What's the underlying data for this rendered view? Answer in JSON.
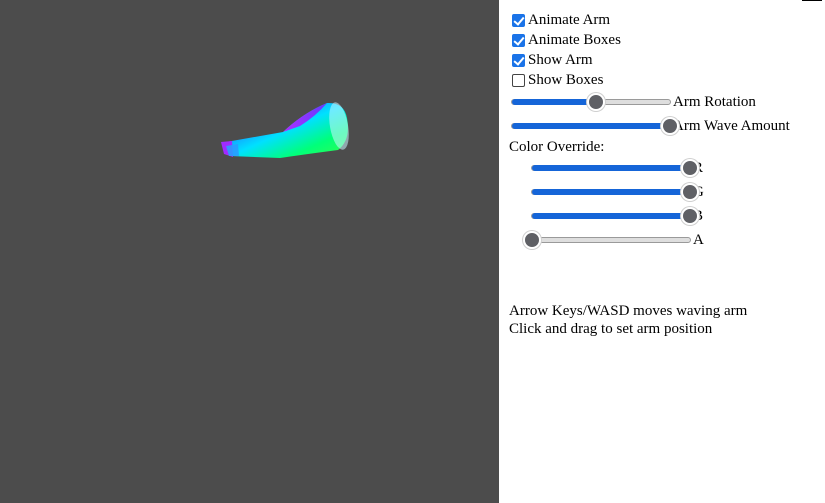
{
  "viewport": {
    "background": "#4c4c4c"
  },
  "controls": {
    "checkboxes": [
      {
        "label": "Animate Arm",
        "checked": true
      },
      {
        "label": "Animate Boxes",
        "checked": true
      },
      {
        "label": "Show Arm",
        "checked": true
      },
      {
        "label": "Show Boxes",
        "checked": false
      }
    ],
    "arm_rotation": {
      "label": "Arm Rotation",
      "value": 0.53
    },
    "arm_wave": {
      "label": "Arm Wave Amount",
      "value": 1.0
    },
    "color_override": {
      "label": "Color Override:",
      "channels": [
        {
          "label": "R",
          "value": 1.0
        },
        {
          "label": "G",
          "value": 1.0
        },
        {
          "label": "B",
          "value": 1.0
        },
        {
          "label": "A",
          "value": 0.0
        }
      ]
    },
    "accent_color": "#1565d8"
  },
  "help": {
    "line1": "Arrow Keys/WASD moves waving arm",
    "line2": "Click and drag to set arm position"
  }
}
